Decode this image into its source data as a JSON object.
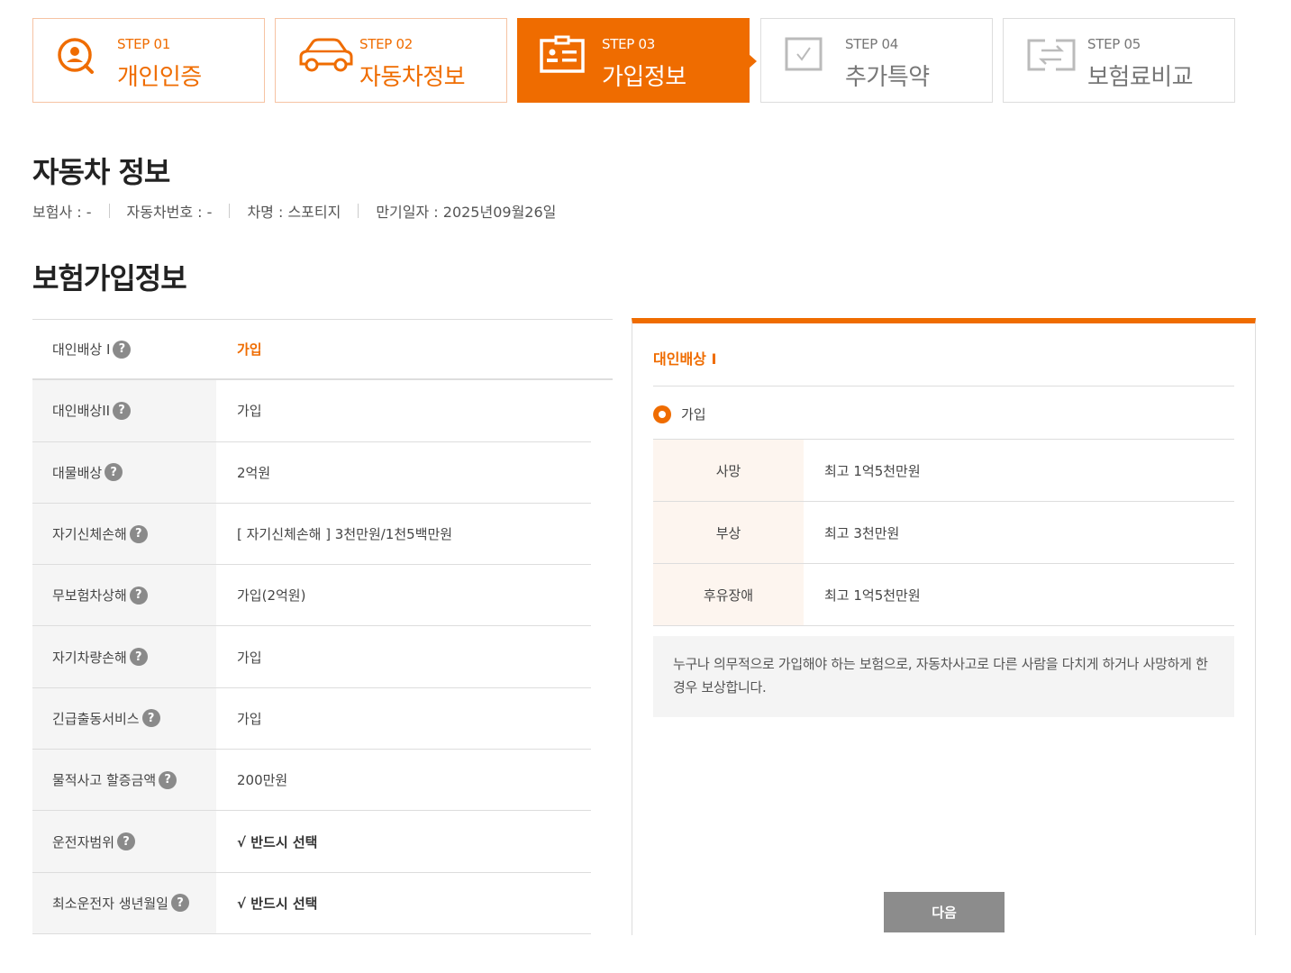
{
  "colors": {
    "accent": "#ef6c00",
    "inactive": "#777777",
    "button": "#8c8c8c"
  },
  "steps": [
    {
      "num": "STEP 01",
      "name": "개인인증",
      "state": "done",
      "icon": "person-search-icon"
    },
    {
      "num": "STEP 02",
      "name": "자동차정보",
      "state": "done",
      "icon": "car-icon"
    },
    {
      "num": "STEP 03",
      "name": "가입정보",
      "state": "active",
      "icon": "id-card-icon"
    },
    {
      "num": "STEP 04",
      "name": "추가특약",
      "state": "inactive",
      "icon": "checkbox-icon"
    },
    {
      "num": "STEP 05",
      "name": "보험료비교",
      "state": "inactive",
      "icon": "compare-icon"
    }
  ],
  "car_info": {
    "title": "자동차 정보",
    "insurer": "보험사 : -",
    "plate": "자동차번호 : -",
    "model": "차명 : 스포티지",
    "expiry": "만기일자 : 2025년09월26일"
  },
  "enroll": {
    "title": "보험가입정보",
    "help_glyph": "?",
    "rows": [
      {
        "label": "대인배상 I",
        "value": "가입"
      },
      {
        "label": "대인배상II",
        "value": "가입"
      },
      {
        "label": "대물배상",
        "value": "2억원"
      },
      {
        "label": "자기신체손해",
        "value": "[ 자기신체손해 ]  3천만원/1천5백만원"
      },
      {
        "label": "무보험차상해",
        "value": "가입(2억원)"
      },
      {
        "label": "자기차량손해",
        "value": "가입"
      },
      {
        "label": "긴급출동서비스",
        "value": "가입"
      },
      {
        "label": "물적사고 할증금액",
        "value": "200만원"
      },
      {
        "label": "운전자범위",
        "value": "√ 반드시 선택"
      },
      {
        "label": "최소운전자 생년월일",
        "value": "√ 반드시 선택"
      }
    ]
  },
  "detail": {
    "title": "대인배상 I",
    "radio_label": "가입",
    "coverage": [
      {
        "k": "사망",
        "v": "최고 1억5천만원"
      },
      {
        "k": "부상",
        "v": "최고 3천만원"
      },
      {
        "k": "후유장애",
        "v": "최고 1억5천만원"
      }
    ],
    "description": "누구나 의무적으로 가입해야 하는 보험으로, 자동차사고로 다른 사람을 다치게 하거나 사망하게 한 경우 보상합니다.",
    "next_label": "다음"
  }
}
